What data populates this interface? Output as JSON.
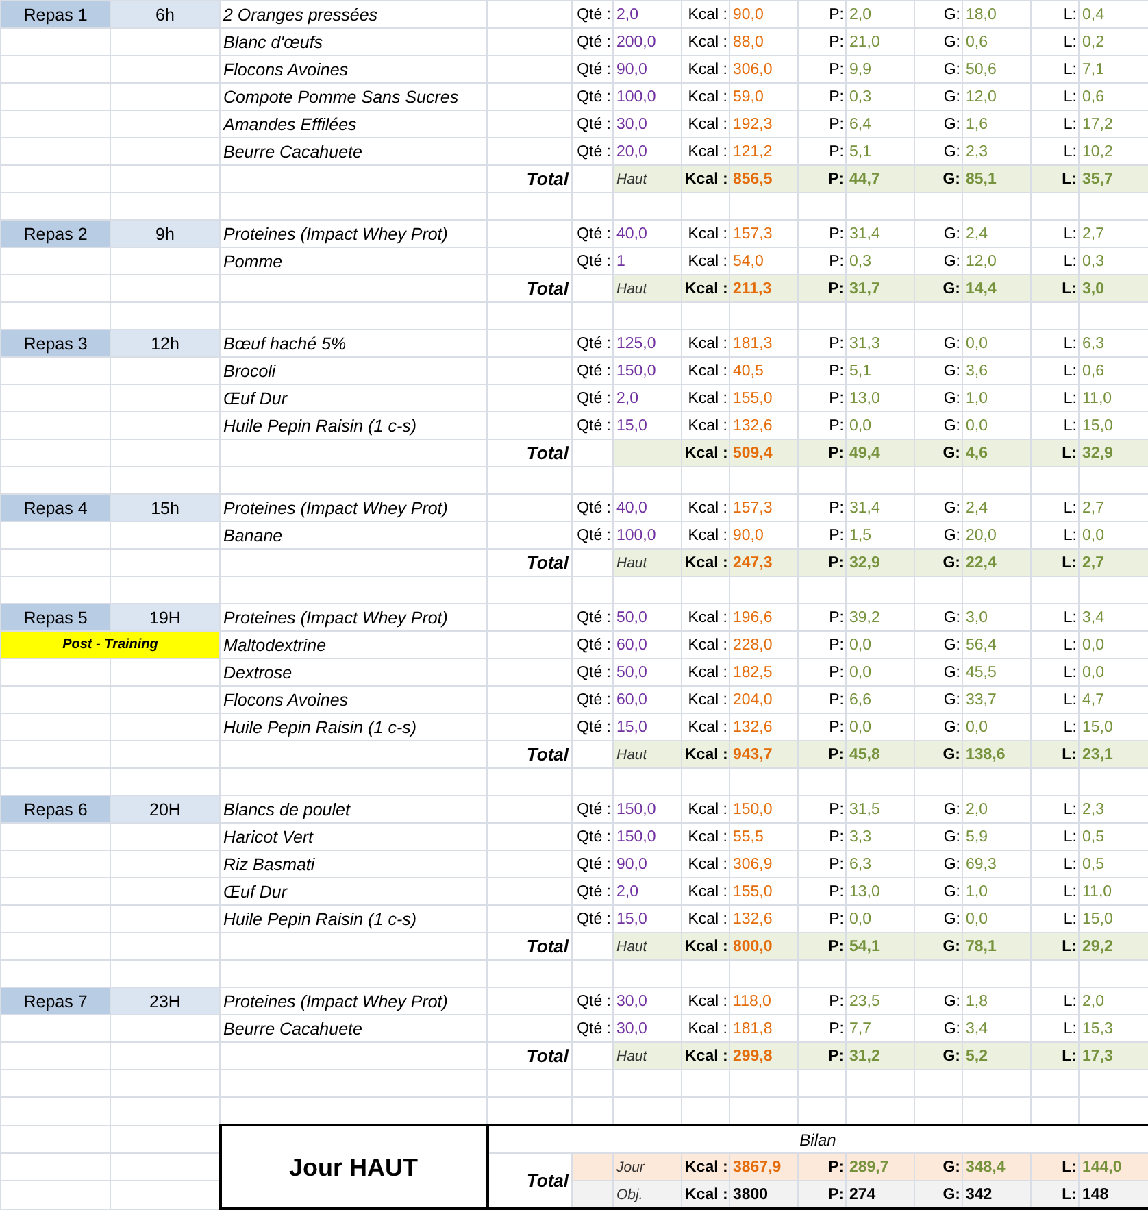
{
  "meals": [
    {
      "label": "Repas 1",
      "time": "6h",
      "items": [
        {
          "food": "2 Oranges pressées",
          "cells": [
            "Qté :",
            "2,0",
            "Kcal :",
            "90,0",
            "P:",
            "2,0",
            "G:",
            "18,0",
            "L:",
            "0,4"
          ]
        },
        {
          "food": "Blanc d'œufs",
          "cells": [
            "Qté :",
            "200,0",
            "Kcal :",
            "88,0",
            "P:",
            "21,0",
            "G:",
            "0,6",
            "L:",
            "0,2"
          ]
        },
        {
          "food": "Flocons Avoines",
          "cells": [
            "Qté :",
            "90,0",
            "Kcal :",
            "306,0",
            "P:",
            "9,9",
            "G:",
            "50,6",
            "L:",
            "7,1"
          ]
        },
        {
          "food": "Compote Pomme Sans Sucres",
          "cells": [
            "Qté :",
            "100,0",
            "Kcal :",
            "59,0",
            "P:",
            "0,3",
            "G:",
            "12,0",
            "L:",
            "0,6"
          ]
        },
        {
          "food": "Amandes Effilées",
          "cells": [
            "Qté :",
            "30,0",
            "Kcal :",
            "192,3",
            "P:",
            "6,4",
            "G:",
            "1,6",
            "L:",
            "17,2"
          ]
        },
        {
          "food": "Beurre Cacahuete",
          "cells": [
            "Qté :",
            "20,0",
            "Kcal :",
            "121,2",
            "P:",
            "5,1",
            "G:",
            "2,3",
            "L:",
            "10,2"
          ]
        }
      ],
      "total": {
        "label": "Total",
        "note": "Haut",
        "cells": [
          "Kcal :",
          "856,5",
          "P:",
          "44,7",
          "G:",
          "85,1",
          "L:",
          "35,7"
        ]
      }
    },
    {
      "label": "Repas 2",
      "time": "9h",
      "items": [
        {
          "food": "Proteines (Impact Whey Prot)",
          "cells": [
            "Qté :",
            "40,0",
            "Kcal :",
            "157,3",
            "P:",
            "31,4",
            "G:",
            "2,4",
            "L:",
            "2,7"
          ]
        },
        {
          "food": "Pomme",
          "cells": [
            "Qté :",
            "1",
            "Kcal :",
            "54,0",
            "P:",
            "0,3",
            "G:",
            "12,0",
            "L:",
            "0,3"
          ]
        }
      ],
      "total": {
        "label": "Total",
        "note": "Haut",
        "cells": [
          "Kcal :",
          "211,3",
          "P:",
          "31,7",
          "G:",
          "14,4",
          "L:",
          "3,0"
        ]
      }
    },
    {
      "label": "Repas 3",
      "time": "12h",
      "items": [
        {
          "food": "Bœuf haché 5%",
          "cells": [
            "Qté :",
            "125,0",
            "Kcal :",
            "181,3",
            "P:",
            "31,3",
            "G:",
            "0,0",
            "L:",
            "6,3"
          ]
        },
        {
          "food": "Brocoli",
          "cells": [
            "Qté :",
            "150,0",
            "Kcal :",
            "40,5",
            "P:",
            "5,1",
            "G:",
            "3,6",
            "L:",
            "0,6"
          ]
        },
        {
          "food": "Œuf Dur",
          "cells": [
            "Qté :",
            "2,0",
            "Kcal :",
            "155,0",
            "P:",
            "13,0",
            "G:",
            "1,0",
            "L:",
            "11,0"
          ]
        },
        {
          "food": "Huile Pepin Raisin (1 c-s)",
          "cells": [
            "Qté :",
            "15,0",
            "Kcal :",
            "132,6",
            "P:",
            "0,0",
            "G:",
            "0,0",
            "L:",
            "15,0"
          ]
        }
      ],
      "total": {
        "label": "Total",
        "cells": [
          "Kcal :",
          "509,4",
          "P:",
          "49,4",
          "G:",
          "4,6",
          "L:",
          "32,9"
        ]
      }
    },
    {
      "label": "Repas 4",
      "time": "15h",
      "items": [
        {
          "food": "Proteines (Impact Whey Prot)",
          "cells": [
            "Qté :",
            "40,0",
            "Kcal :",
            "157,3",
            "P:",
            "31,4",
            "G:",
            "2,4",
            "L:",
            "2,7"
          ]
        },
        {
          "food": "Banane",
          "cells": [
            "Qté :",
            "100,0",
            "Kcal :",
            "90,0",
            "P:",
            "1,5",
            "G:",
            "20,0",
            "L:",
            "0,0"
          ]
        }
      ],
      "total": {
        "label": "Total",
        "note": "Haut",
        "cells": [
          "Kcal :",
          "247,3",
          "P:",
          "32,9",
          "G:",
          "22,4",
          "L:",
          "2,7"
        ]
      }
    },
    {
      "label": "Repas 5",
      "time": "19H",
      "tag": "Post - Training",
      "items": [
        {
          "food": "Proteines (Impact Whey Prot)",
          "cells": [
            "Qté :",
            "50,0",
            "Kcal :",
            "196,6",
            "P:",
            "39,2",
            "G:",
            "3,0",
            "L:",
            "3,4"
          ]
        },
        {
          "food": "Maltodextrine",
          "cells": [
            "Qté :",
            "60,0",
            "Kcal :",
            "228,0",
            "P:",
            "0,0",
            "G:",
            "56,4",
            "L:",
            "0,0"
          ]
        },
        {
          "food": "Dextrose",
          "cells": [
            "Qté :",
            "50,0",
            "Kcal :",
            "182,5",
            "P:",
            "0,0",
            "G:",
            "45,5",
            "L:",
            "0,0"
          ]
        },
        {
          "food": "Flocons Avoines",
          "cells": [
            "Qté :",
            "60,0",
            "Kcal :",
            "204,0",
            "P:",
            "6,6",
            "G:",
            "33,7",
            "L:",
            "4,7"
          ]
        },
        {
          "food": "Huile Pepin Raisin (1 c-s)",
          "cells": [
            "Qté :",
            "15,0",
            "Kcal :",
            "132,6",
            "P:",
            "0,0",
            "G:",
            "0,0",
            "L:",
            "15,0"
          ]
        }
      ],
      "total": {
        "label": "Total",
        "note": "Haut",
        "cells": [
          "Kcal :",
          "943,7",
          "P:",
          "45,8",
          "G:",
          "138,6",
          "L:",
          "23,1"
        ]
      }
    },
    {
      "label": "Repas 6",
      "time": "20H",
      "items": [
        {
          "food": "Blancs de poulet",
          "cells": [
            "Qté :",
            "150,0",
            "Kcal :",
            "150,0",
            "P:",
            "31,5",
            "G:",
            "2,0",
            "L:",
            "2,3"
          ]
        },
        {
          "food": "Haricot Vert",
          "cells": [
            "Qté :",
            "150,0",
            "Kcal :",
            "55,5",
            "P:",
            "3,3",
            "G:",
            "5,9",
            "L:",
            "0,5"
          ]
        },
        {
          "food": "Riz Basmati",
          "cells": [
            "Qté :",
            "90,0",
            "Kcal :",
            "306,9",
            "P:",
            "6,3",
            "G:",
            "69,3",
            "L:",
            "0,5"
          ]
        },
        {
          "food": "Œuf Dur",
          "cells": [
            "Qté :",
            "2,0",
            "Kcal :",
            "155,0",
            "P:",
            "13,0",
            "G:",
            "1,0",
            "L:",
            "11,0"
          ]
        },
        {
          "food": "Huile Pepin Raisin (1 c-s)",
          "cells": [
            "Qté :",
            "15,0",
            "Kcal :",
            "132,6",
            "P:",
            "0,0",
            "G:",
            "0,0",
            "L:",
            "15,0"
          ]
        }
      ],
      "total": {
        "label": "Total",
        "note": "Haut",
        "cells": [
          "Kcal :",
          "800,0",
          "P:",
          "54,1",
          "G:",
          "78,1",
          "L:",
          "29,2"
        ]
      }
    },
    {
      "label": "Repas 7",
      "time": "23H",
      "items": [
        {
          "food": "Proteines (Impact Whey Prot)",
          "cells": [
            "Qté :",
            "30,0",
            "Kcal :",
            "118,0",
            "P:",
            "23,5",
            "G:",
            "1,8",
            "L:",
            "2,0"
          ]
        },
        {
          "food": "Beurre Cacahuete",
          "cells": [
            "Qté :",
            "30,0",
            "Kcal :",
            "181,8",
            "P:",
            "7,7",
            "G:",
            "3,4",
            "L:",
            "15,3"
          ]
        }
      ],
      "total": {
        "label": "Total",
        "note": "Haut",
        "cells": [
          "Kcal :",
          "299,8",
          "P:",
          "31,2",
          "G:",
          "5,2",
          "L:",
          "17,3"
        ]
      }
    }
  ],
  "summary": {
    "day_label": "Jour HAUT",
    "title": "Bilan",
    "total_label": "Total",
    "rows": [
      {
        "kind": "actual",
        "note": "Jour",
        "cells": [
          "Kcal :",
          "3867,9",
          "P:",
          "289,7",
          "G:",
          "348,4",
          "L:",
          "144,0"
        ]
      },
      {
        "kind": "target",
        "note": "Obj.",
        "cells": [
          "Kcal :",
          "3800",
          "P:",
          "274",
          "G:",
          "342",
          "L:",
          "148"
        ]
      }
    ]
  }
}
